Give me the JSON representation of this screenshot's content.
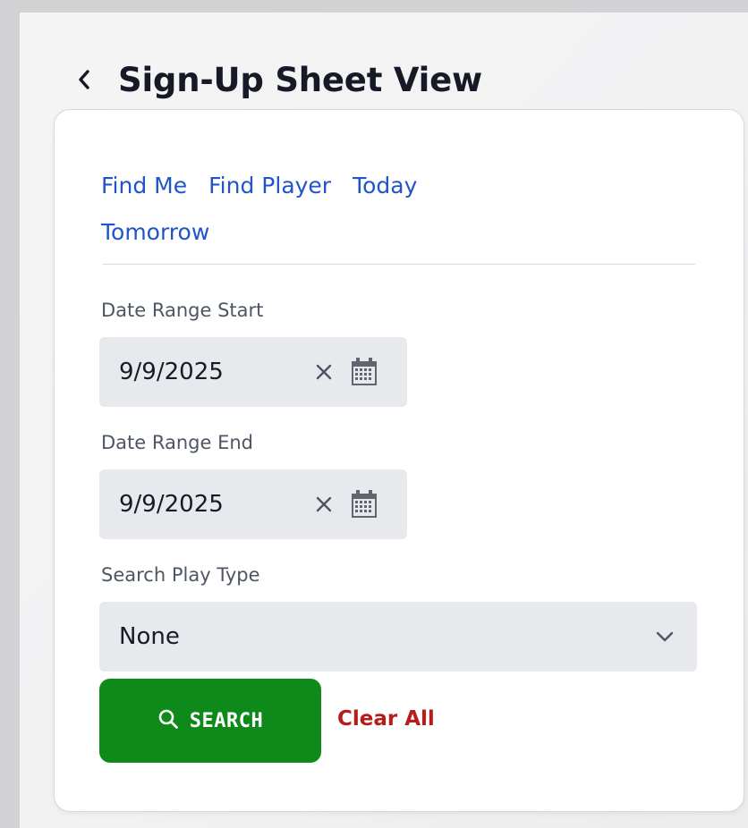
{
  "header": {
    "back_icon": "chevron-left-icon",
    "title": "Sign-Up Sheet View"
  },
  "quick_links": [
    {
      "label": "Find Me"
    },
    {
      "label": "Find Player"
    },
    {
      "label": "Today"
    },
    {
      "label": "Tomorrow"
    }
  ],
  "form": {
    "start": {
      "label": "Date Range Start",
      "value": "9/9/2025",
      "clear_icon": "close-icon",
      "calendar_icon": "calendar-icon"
    },
    "end": {
      "label": "Date Range End",
      "value": "9/9/2025",
      "clear_icon": "close-icon",
      "calendar_icon": "calendar-icon"
    },
    "play_type": {
      "label": "Search Play Type",
      "value": "None",
      "icon": "chevron-down-icon"
    }
  },
  "actions": {
    "search_label": "SEARCH",
    "search_icon": "search-icon",
    "clear_label": "Clear All"
  },
  "colors": {
    "link": "#2154c8",
    "search_button": "#0e8a1b",
    "clear_all": "#b71c1c",
    "field_bg": "#e7e9ec"
  }
}
